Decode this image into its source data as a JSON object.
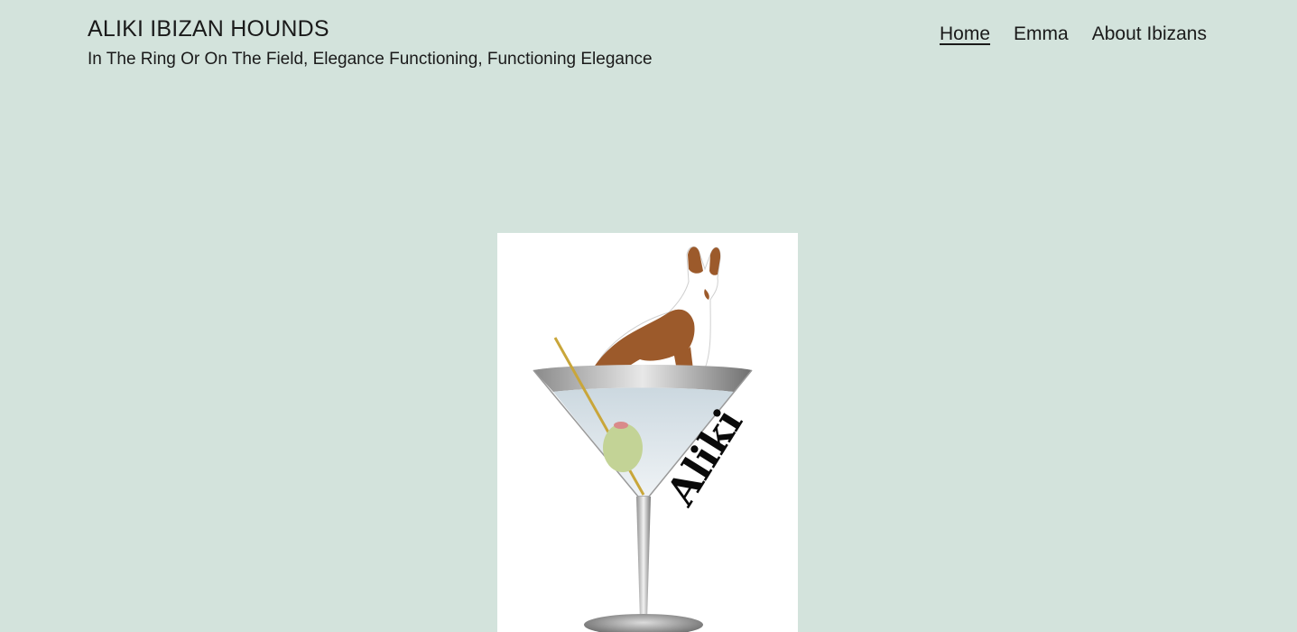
{
  "site": {
    "title": "ALIKI IBIZAN HOUNDS",
    "tagline": "In The Ring Or On The Field, Elegance Functioning, Functioning Elegance"
  },
  "nav": {
    "items": [
      {
        "label": "Home",
        "current": true
      },
      {
        "label": "Emma",
        "current": false
      },
      {
        "label": "About Ibizans",
        "current": false
      }
    ]
  },
  "hero": {
    "logo_text": "Aliki",
    "colors": {
      "background": "#d3e3dc",
      "hound_coat": "#9c5a2b",
      "olive": "#c3d396",
      "toothpick": "#c9a63a"
    }
  }
}
